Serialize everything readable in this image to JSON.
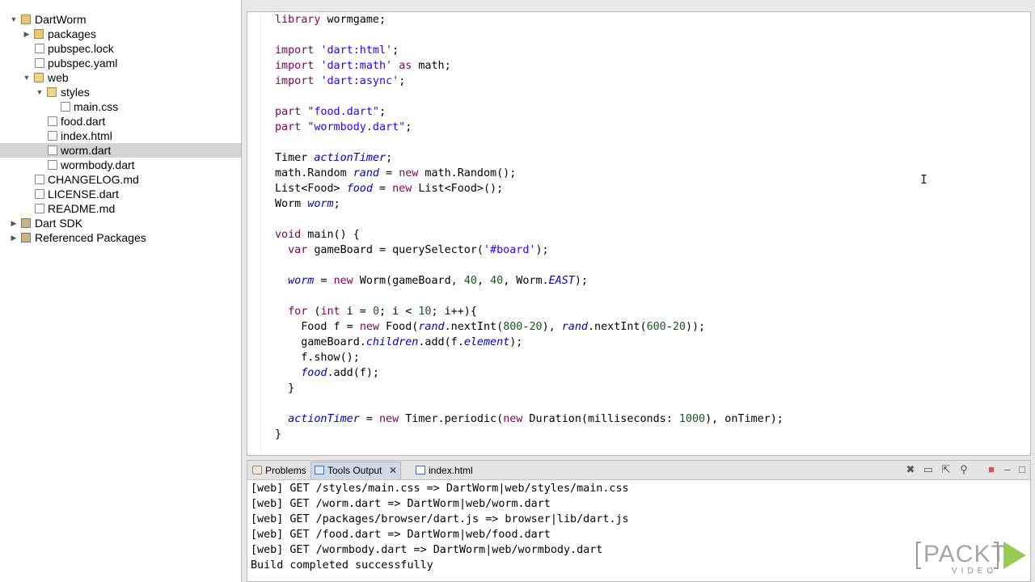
{
  "explorer": {
    "items": [
      {
        "label": "DartWorm",
        "icon": "project-folder-icon",
        "expanded": true
      },
      {
        "label": "packages",
        "icon": "folder-icon",
        "expanded": false
      },
      {
        "label": "pubspec.lock",
        "icon": "file-icon"
      },
      {
        "label": "pubspec.yaml",
        "icon": "file-icon"
      },
      {
        "label": "web",
        "icon": "folder-icon",
        "expanded": true
      },
      {
        "label": "styles",
        "icon": "folder-icon",
        "expanded": true
      },
      {
        "label": "main.css",
        "icon": "file-icon"
      },
      {
        "label": "food.dart",
        "icon": "dart-file-icon"
      },
      {
        "label": "index.html",
        "icon": "file-icon"
      },
      {
        "label": "worm.dart",
        "icon": "dart-file-icon",
        "selected": true
      },
      {
        "label": "wormbody.dart",
        "icon": "dart-file-icon"
      },
      {
        "label": "CHANGELOG.md",
        "icon": "file-icon"
      },
      {
        "label": "LICENSE.dart",
        "icon": "dart-file-icon"
      },
      {
        "label": "README.md",
        "icon": "file-icon"
      },
      {
        "label": "Dart SDK",
        "icon": "library-icon",
        "expanded": false
      },
      {
        "label": "Referenced Packages",
        "icon": "library-icon",
        "expanded": false
      }
    ]
  },
  "editor": {
    "lines": [
      "library wormgame;",
      "",
      "import 'dart:html';",
      "import 'dart:math' as math;",
      "import 'dart:async';",
      "",
      "part \"food.dart\";",
      "part \"wormbody.dart\";",
      "",
      "Timer actionTimer;",
      "math.Random rand = new math.Random();",
      "List<Food> food = new List<Food>();",
      "Worm worm;",
      "",
      "void main() {",
      "  var gameBoard = querySelector('#board');",
      "",
      "  worm = new Worm(gameBoard, 40, 40, Worm.EAST);",
      "",
      "  for (int i = 0; i < 10; i++){",
      "    Food f = new Food(rand.nextInt(800-20), rand.nextInt(600-20));",
      "    gameBoard.children.add(f.element);",
      "    f.show();",
      "    food.add(f);",
      "  }",
      "",
      "  actionTimer = new Timer.periodic(new Duration(milliseconds: 1000), onTimer);",
      "}"
    ]
  },
  "bottom_panel": {
    "tabs": [
      {
        "label": "Problems",
        "icon": "problems-icon"
      },
      {
        "label": "Tools Output",
        "icon": "console-icon",
        "active": true
      },
      {
        "label": "index.html",
        "icon": "html-file-icon"
      }
    ],
    "console_lines": [
      "[web] GET /styles/main.css => DartWorm|web/styles/main.css",
      "[web] GET /worm.dart => DartWorm|web/worm.dart",
      "[web] GET /packages/browser/dart.js => browser|lib/dart.js",
      "[web] GET /food.dart => DartWorm|web/food.dart",
      "[web] GET /wormbody.dart => DartWorm|web/wormbody.dart",
      "Build completed successfully"
    ]
  },
  "watermark": {
    "brand": "PACKT",
    "sub": "VIDEO"
  },
  "colors": {
    "keyword": "#7f0055",
    "string": "#2a00ff",
    "number": "#125a1b",
    "field": "#0000c0",
    "selection": "#d4d4d4",
    "active_tab": "#cfd9e6"
  }
}
